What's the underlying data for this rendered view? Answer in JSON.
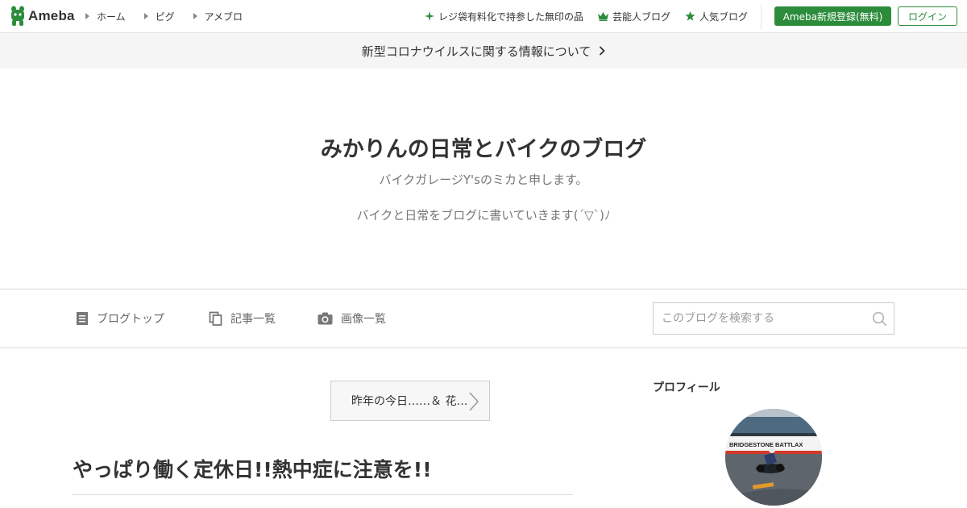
{
  "header": {
    "logo_text": "Ameba",
    "nav": [
      "ホーム",
      "ピグ",
      "アメブロ"
    ],
    "links": [
      {
        "label": "レジ袋有料化で持参した無印の品",
        "icon": "sparkle-icon"
      },
      {
        "label": "芸能人ブログ",
        "icon": "crown-icon"
      },
      {
        "label": "人気ブログ",
        "icon": "star-icon"
      }
    ],
    "register_label": "Ameba新規登録(無料)",
    "login_label": "ログイン"
  },
  "notice": {
    "text": "新型コロナウイルスに関する情報について"
  },
  "blog": {
    "title": "みかりんの日常とバイクのブログ",
    "subtitle": "バイクガレージY'sのミカと申します。",
    "description": "バイクと日常をブログに書いていきます(´▽`)ﾉ"
  },
  "blognav": {
    "items": [
      {
        "label": "ブログトップ",
        "icon": "document-icon"
      },
      {
        "label": "記事一覧",
        "icon": "copy-icon"
      },
      {
        "label": "画像一覧",
        "icon": "camera-icon"
      }
    ],
    "search_placeholder": "このブログを検索する"
  },
  "main": {
    "prev_article": "昨年の今日……＆ 花…",
    "article_title": "やっぱり働く定休日!!熱中症に注意を!!"
  },
  "sidebar": {
    "profile_heading": "プロフィール",
    "avatar_banner_text": "BRIDGESTONE BATTLAX"
  },
  "colors": {
    "accent": "#2d8c3c",
    "notice_bg": "#f5f5f5"
  }
}
